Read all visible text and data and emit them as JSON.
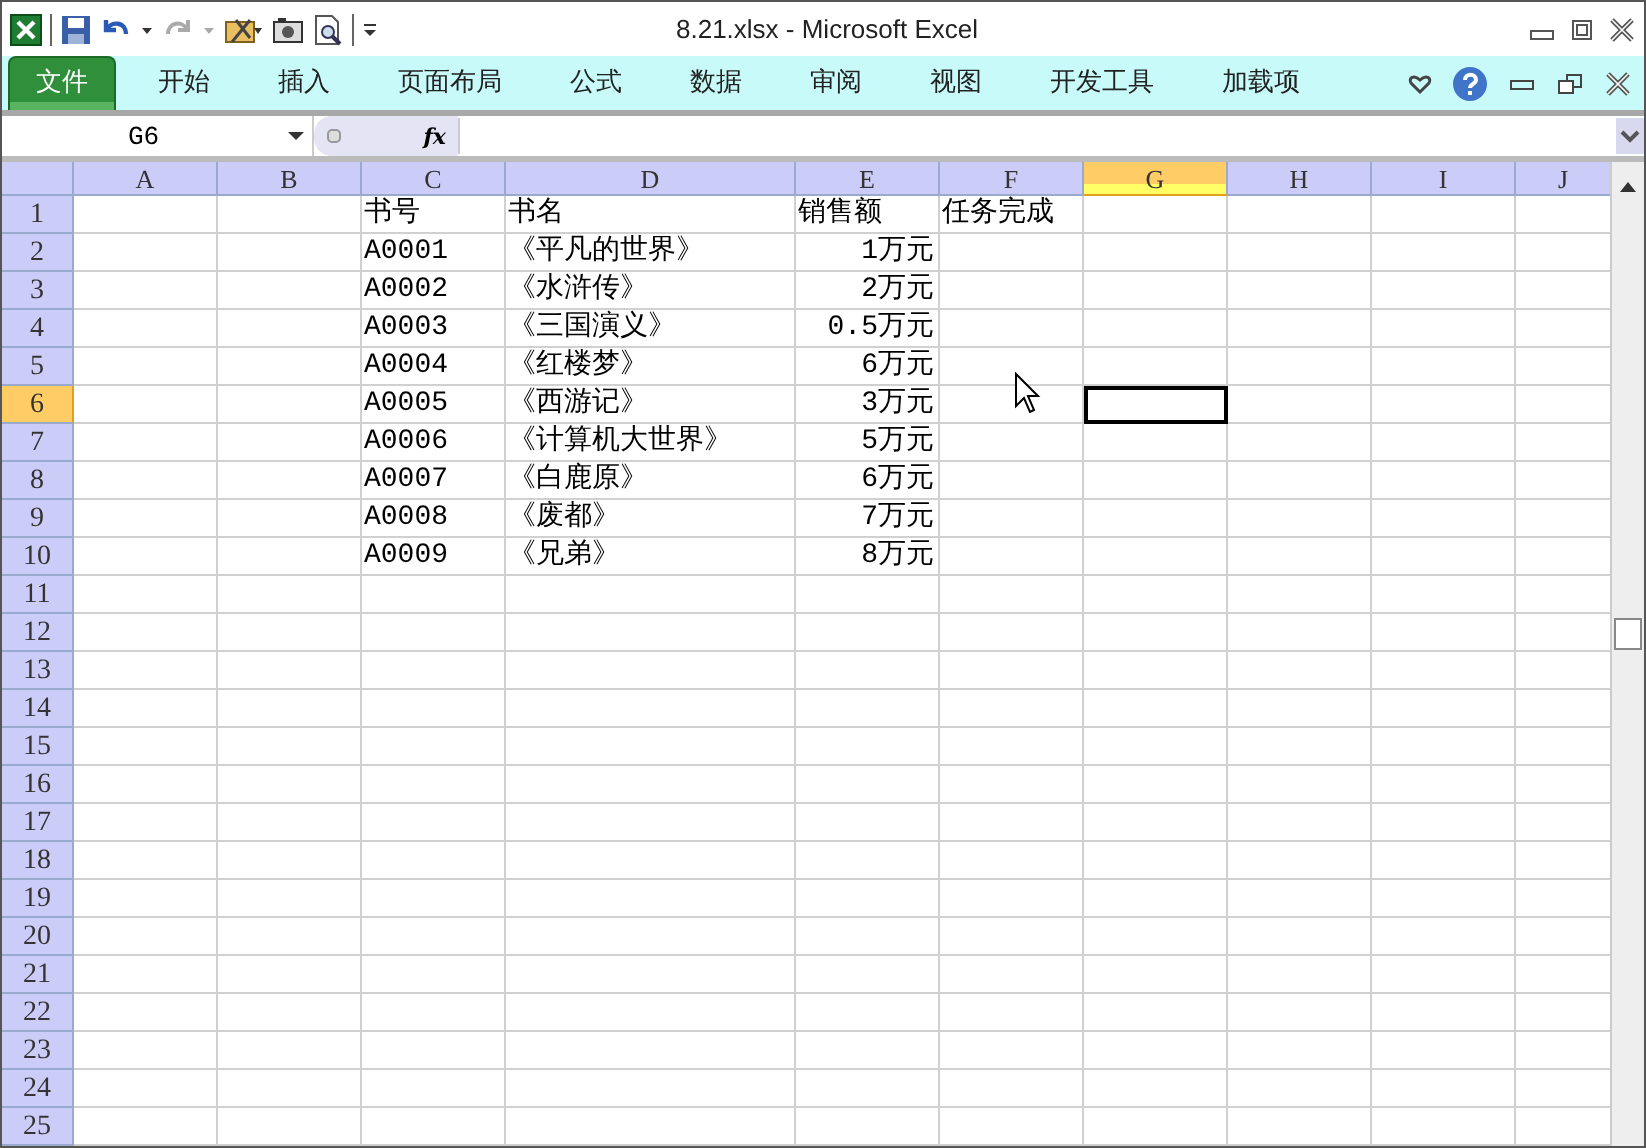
{
  "window": {
    "title": "8.21.xlsx  -  Microsoft Excel"
  },
  "tabs": [
    {
      "label": "文件",
      "selected": true
    },
    {
      "label": "开始",
      "selected": false
    },
    {
      "label": "插入",
      "selected": false
    },
    {
      "label": "页面布局",
      "selected": false
    },
    {
      "label": "公式",
      "selected": false
    },
    {
      "label": "数据",
      "selected": false
    },
    {
      "label": "审阅",
      "selected": false
    },
    {
      "label": "视图",
      "selected": false
    },
    {
      "label": "开发工具",
      "selected": false
    },
    {
      "label": "加载项",
      "selected": false
    }
  ],
  "formula_bar": {
    "name_box": "G6",
    "fx": "fx"
  },
  "columns": [
    {
      "label": "A",
      "selected": false
    },
    {
      "label": "B",
      "selected": false
    },
    {
      "label": "C",
      "selected": false
    },
    {
      "label": "D",
      "selected": false
    },
    {
      "label": "E",
      "selected": false
    },
    {
      "label": "F",
      "selected": false
    },
    {
      "label": "G",
      "selected": true
    },
    {
      "label": "H",
      "selected": false
    },
    {
      "label": "I",
      "selected": false
    },
    {
      "label": "J",
      "selected": false
    }
  ],
  "rows": [
    {
      "label": "1",
      "selected": false,
      "cells": {
        "C": "书号",
        "D": "书名",
        "E": "销售额",
        "F": "任务完成"
      }
    },
    {
      "label": "2",
      "selected": false,
      "cells": {
        "C": "A0001",
        "D": "《平凡的世界》",
        "E": {
          "text": "1万元",
          "kind": "number"
        }
      }
    },
    {
      "label": "3",
      "selected": false,
      "cells": {
        "C": "A0002",
        "D": "《水浒传》",
        "E": {
          "text": "2万元",
          "kind": "number"
        }
      }
    },
    {
      "label": "4",
      "selected": false,
      "cells": {
        "C": "A0003",
        "D": "《三国演义》",
        "E": {
          "text": "0.5万元",
          "kind": "number"
        }
      }
    },
    {
      "label": "5",
      "selected": false,
      "cells": {
        "C": "A0004",
        "D": "《红楼梦》",
        "E": {
          "text": "6万元",
          "kind": "number"
        }
      }
    },
    {
      "label": "6",
      "selected": true,
      "cells": {
        "C": "A0005",
        "D": "《西游记》",
        "E": {
          "text": "3万元",
          "kind": "number"
        }
      }
    },
    {
      "label": "7",
      "selected": false,
      "cells": {
        "C": "A0006",
        "D": "《计算机大世界》",
        "E": {
          "text": "5万元",
          "kind": "number"
        }
      }
    },
    {
      "label": "8",
      "selected": false,
      "cells": {
        "C": "A0007",
        "D": "《白鹿原》",
        "E": {
          "text": "6万元",
          "kind": "number"
        }
      }
    },
    {
      "label": "9",
      "selected": false,
      "cells": {
        "C": "A0008",
        "D": "《废都》",
        "E": {
          "text": "7万元",
          "kind": "number"
        }
      }
    },
    {
      "label": "10",
      "selected": false,
      "cells": {
        "C": "A0009",
        "D": "《兄弟》",
        "E": {
          "text": "8万元",
          "kind": "number"
        }
      }
    },
    {
      "label": "11",
      "selected": false,
      "cells": {}
    },
    {
      "label": "12",
      "selected": false,
      "cells": {}
    },
    {
      "label": "13",
      "selected": false,
      "cells": {}
    },
    {
      "label": "14",
      "selected": false,
      "cells": {}
    },
    {
      "label": "15",
      "selected": false,
      "cells": {}
    },
    {
      "label": "16",
      "selected": false,
      "cells": {}
    },
    {
      "label": "17",
      "selected": false,
      "cells": {}
    },
    {
      "label": "18",
      "selected": false,
      "cells": {}
    },
    {
      "label": "19",
      "selected": false,
      "cells": {}
    },
    {
      "label": "20",
      "selected": false,
      "cells": {}
    },
    {
      "label": "21",
      "selected": false,
      "cells": {}
    },
    {
      "label": "22",
      "selected": false,
      "cells": {}
    },
    {
      "label": "23",
      "selected": false,
      "cells": {}
    },
    {
      "label": "24",
      "selected": false,
      "cells": {}
    },
    {
      "label": "25",
      "selected": false,
      "cells": {}
    }
  ]
}
